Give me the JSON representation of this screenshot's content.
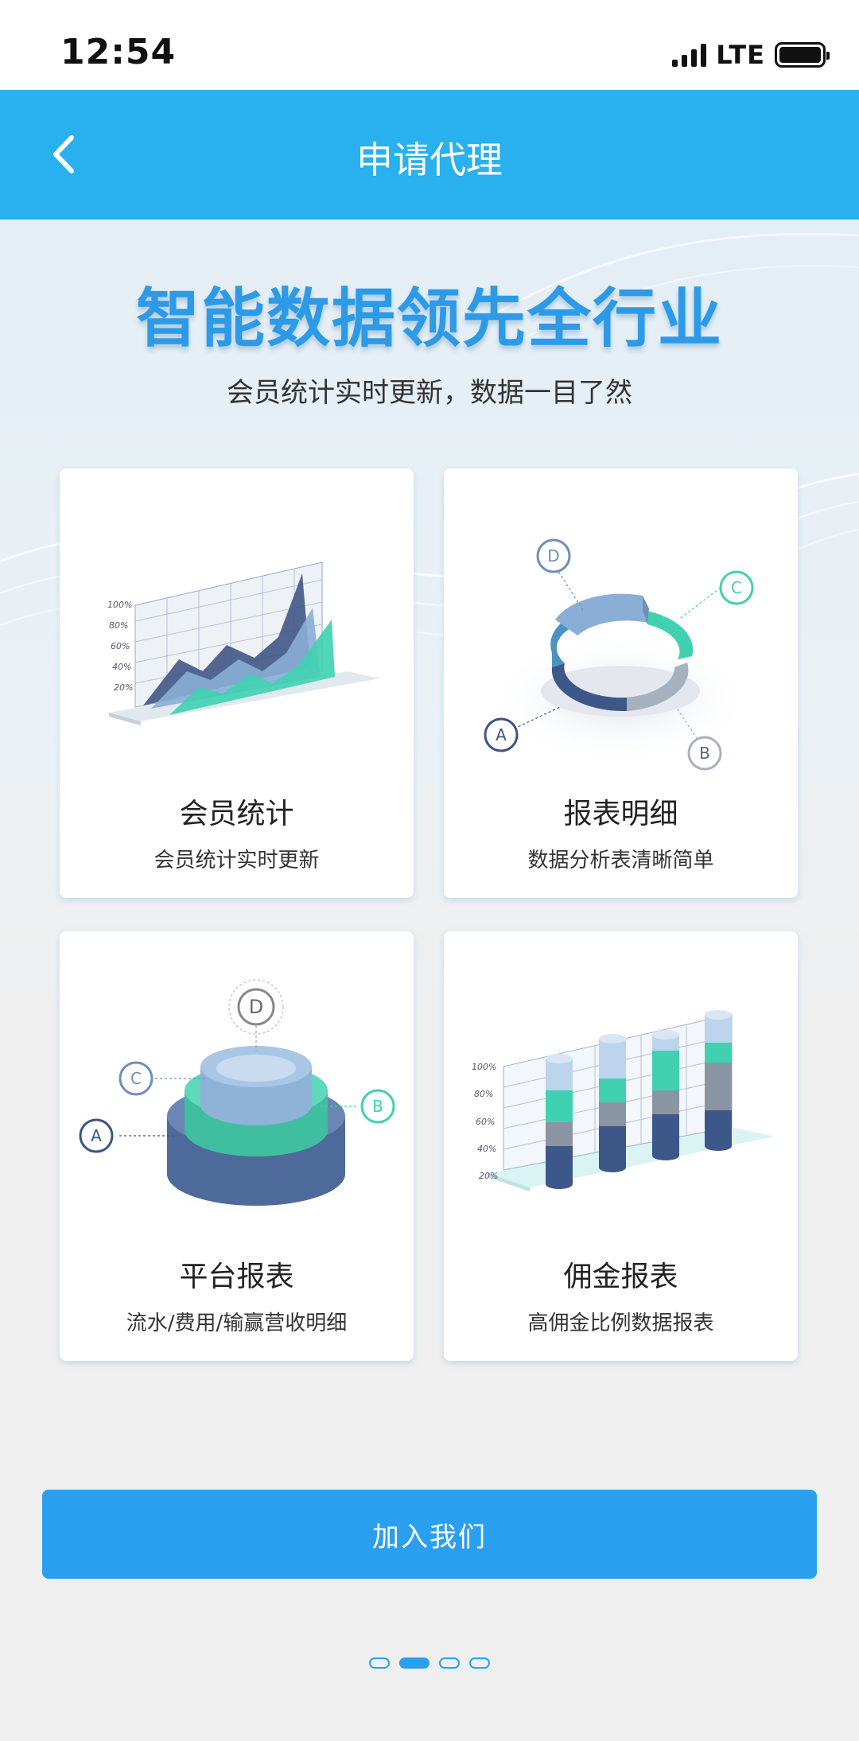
{
  "status_bar": {
    "time": "12:54",
    "network": "LTE"
  },
  "nav": {
    "title": "申请代理",
    "back_icon": "chevron-left-icon"
  },
  "hero": {
    "headline": "智能数据领先全行业",
    "subheadline": "会员统计实时更新，数据一目了然"
  },
  "cards": [
    {
      "title": "会员统计",
      "desc": "会员统计实时更新",
      "axis_labels": [
        "100%",
        "80%",
        "60%",
        "40%",
        "20%"
      ]
    },
    {
      "title": "报表明细",
      "desc": "数据分析表清晰简单",
      "markers": [
        "A",
        "B",
        "C",
        "D"
      ]
    },
    {
      "title": "平台报表",
      "desc": "流水/费用/输赢营收明细",
      "markers": [
        "A",
        "B",
        "C",
        "D"
      ]
    },
    {
      "title": "佣金报表",
      "desc": "高佣金比例数据报表",
      "axis_labels": [
        "100%",
        "80%",
        "60%",
        "40%",
        "20%"
      ]
    }
  ],
  "join_button": {
    "label": "加入我们"
  },
  "pager": {
    "count": 4,
    "active_index": 1
  },
  "colors": {
    "nav": "#29b0ee",
    "accent": "#2a9ff0",
    "teal": "#3fd1b0",
    "navy": "#3c5486"
  }
}
